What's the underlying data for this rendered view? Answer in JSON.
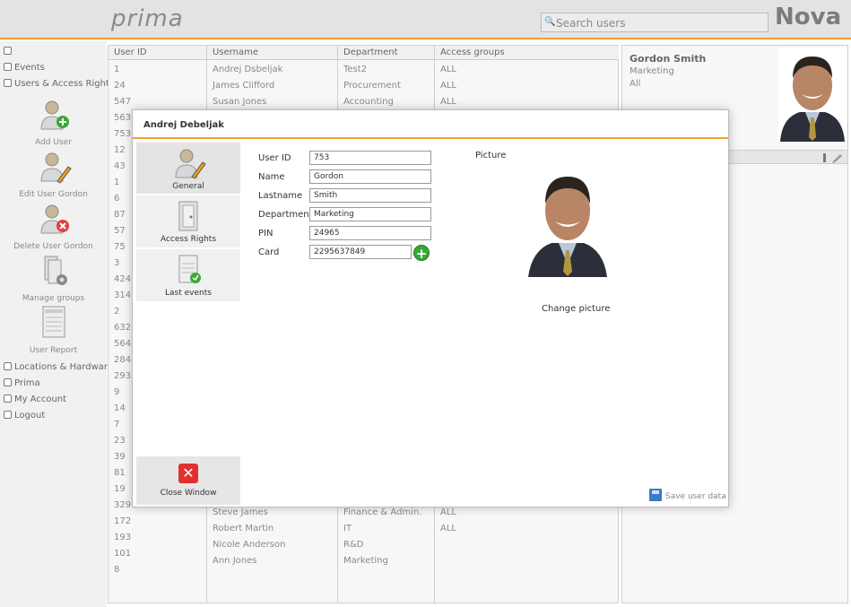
{
  "header": {
    "logo": "prima",
    "search_placeholder": "Search users",
    "brand": "Nova"
  },
  "sidebar": {
    "nav_top": [
      {
        "label": ""
      },
      {
        "label": "Events"
      },
      {
        "label": "Users & Access Rights"
      }
    ],
    "tools": [
      {
        "label": "Add User",
        "icon": "add-user-icon"
      },
      {
        "label": "Edit User Gordon",
        "icon": "edit-user-icon"
      },
      {
        "label": "Delete User Gordon",
        "icon": "delete-user-icon"
      },
      {
        "label": "Manage groups",
        "icon": "manage-groups-icon"
      },
      {
        "label": "User Report",
        "icon": "report-icon"
      }
    ],
    "nav_bottom": [
      {
        "label": "Locations & Hardware"
      },
      {
        "label": "Prima"
      },
      {
        "label": "My Account"
      },
      {
        "label": "Logout"
      }
    ]
  },
  "table": {
    "headers": [
      "User ID",
      "Username",
      "Department",
      "Access groups"
    ],
    "ids": [
      "1",
      "24",
      "547",
      "563",
      "753",
      "12",
      "43",
      "1",
      "6",
      "87",
      "57",
      "75",
      "3",
      "424",
      "314",
      "2",
      "632",
      "564",
      "284",
      "293",
      "9",
      "14",
      "7",
      "23",
      "39",
      "81",
      "19",
      "329",
      "172",
      "193",
      "101",
      "8"
    ],
    "top_rows": [
      {
        "username": "Andrej Dsbeljak",
        "department": "Test2",
        "access": "ALL"
      },
      {
        "username": "James Clifford",
        "department": "Procurement",
        "access": "ALL"
      },
      {
        "username": "Susan Jones",
        "department": "Accounting",
        "access": "ALL"
      }
    ],
    "bottom_rows": [
      {
        "username": "Steve James",
        "department": "Finance & Admin.",
        "access": "ALL"
      },
      {
        "username": "Robert Martin",
        "department": "IT",
        "access": "ALL"
      },
      {
        "username": "Nicole Anderson",
        "department": "R&D",
        "access": ""
      },
      {
        "username": "Ann Jones",
        "department": "Marketing",
        "access": ""
      }
    ]
  },
  "right_panel": {
    "name": "Gordon Smith",
    "department": "Marketing",
    "group": "All"
  },
  "modal": {
    "title": "Andrej Debeljak",
    "nav": [
      {
        "label": "General"
      },
      {
        "label": "Access Rights"
      },
      {
        "label": "Last events"
      }
    ],
    "fields": {
      "user_id_label": "User ID",
      "user_id": "753",
      "name_label": "Name",
      "name": "Gordon",
      "lastname_label": "Lastname",
      "lastname": "Smith",
      "department_label": "Department",
      "department": "Marketing",
      "pin_label": "PIN",
      "pin": "24965",
      "card_label": "Card",
      "card": "2295637849"
    },
    "picture_label": "Picture",
    "change_picture": "Change picture",
    "close_label": "Close Window",
    "save_label": "Save user data"
  },
  "colors": {
    "accent": "#f0a030",
    "header_bg": "#e3e3e3",
    "add_green": "#3aa83a",
    "close_red": "#e03030"
  }
}
